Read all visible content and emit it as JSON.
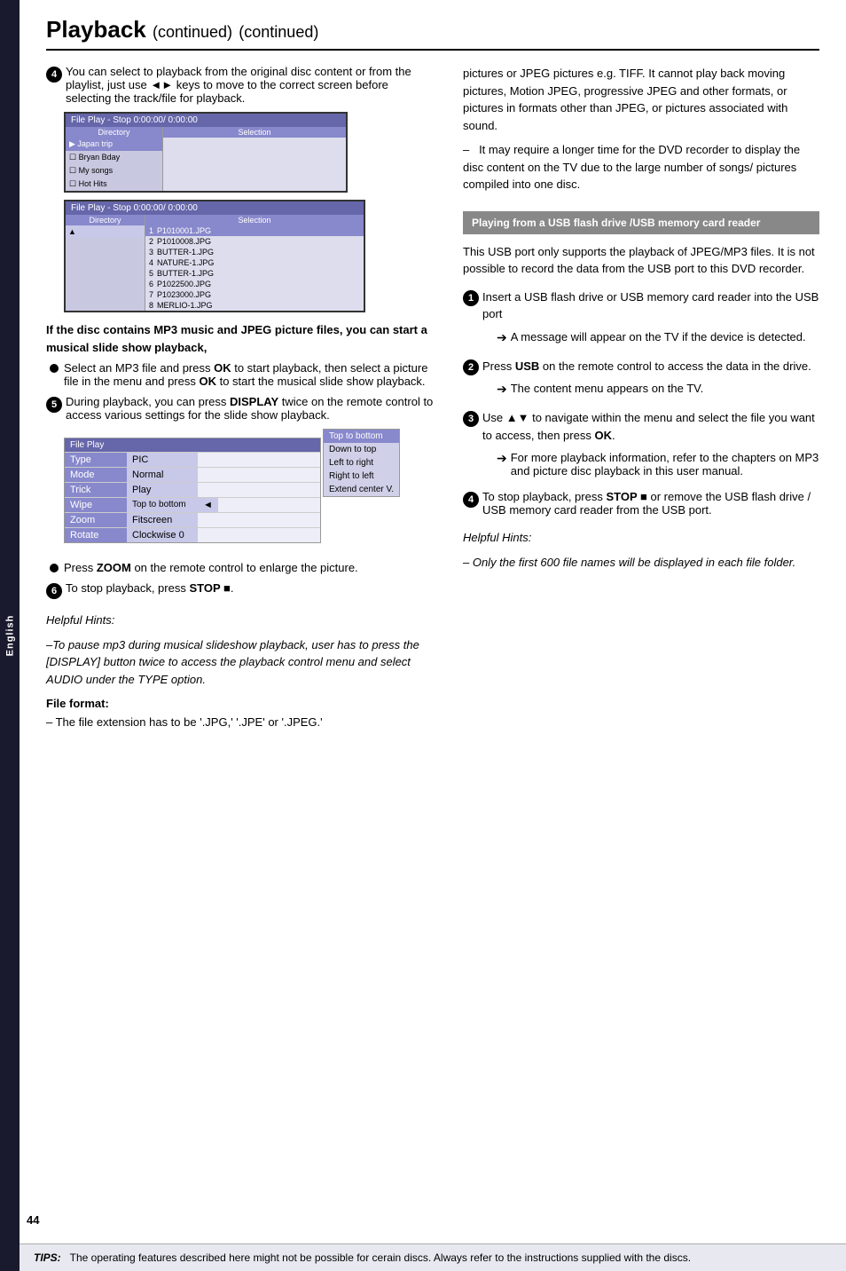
{
  "sidebar": {
    "label": "English"
  },
  "header": {
    "title": "Playback",
    "continued": "(continued)"
  },
  "left_col": {
    "step4": {
      "num": "4",
      "text": "You can select to playback from the original disc content or from the playlist, just use ",
      "keys": "◄►",
      "text2": " keys to move to the correct screen before selecting the track/file for playback."
    },
    "fileplay_screen1": {
      "title": "File Play - Stop 0:00:00/ 0:00:00",
      "dir_header": "Directory",
      "sel_header": "Selection",
      "dir_items": [
        "Japan trip",
        "Bryan Bday",
        "My songs",
        "Hot Hits"
      ],
      "dir_selected": 0
    },
    "fileplay_screen2": {
      "title": "File Play - Stop 0:00:00/ 0:00:00",
      "dir_header": "Directory",
      "sel_header": "Selection",
      "files": [
        {
          "num": "1",
          "name": "P1010001.JPG"
        },
        {
          "num": "2",
          "name": "P1010008.JPG"
        },
        {
          "num": "3",
          "name": "BUTTER-1.JPG"
        },
        {
          "num": "4",
          "name": "NATURE-1.JPG"
        },
        {
          "num": "5",
          "name": "BUTTER-1.JPG"
        },
        {
          "num": "6",
          "name": "P1022500.JPG"
        },
        {
          "num": "7",
          "name": "P1023000.JPG"
        },
        {
          "num": "8",
          "name": "MERLIO-1.JPG"
        }
      ]
    },
    "mp3_jpeg_header": "If the disc contains MP3 music and JPEG picture files, you can start a musical slide show playback,",
    "bullet1": {
      "text1": "Select an MP3 file and press ",
      "ok": "OK",
      "text2": " to start playback, then select a picture file in the menu and press ",
      "ok2": "OK",
      "text3": " to start the musical slide show playback."
    },
    "step5": {
      "num": "5",
      "text1": "During playback, you can press ",
      "display": "DISPLAY",
      "text2": " twice on the remote control to access various settings for the slide show playback."
    },
    "fileplay_settings": {
      "title": "File Play",
      "rows": [
        {
          "label": "Type",
          "value": "PIC"
        },
        {
          "label": "Mode",
          "value": "Normal"
        },
        {
          "label": "Trick",
          "value": "Play"
        },
        {
          "label": "Wipe",
          "value": "Top to bottom",
          "has_arrow": true,
          "has_dropdown": true
        },
        {
          "label": "Zoom",
          "value": "Fitscreen"
        },
        {
          "label": "Rotate",
          "value": "Clockwise 0"
        }
      ],
      "dropdown_items": [
        {
          "text": "Top to bottom",
          "selected": true
        },
        {
          "text": "Down to top",
          "selected": false
        },
        {
          "text": "Left to right",
          "selected": false
        },
        {
          "text": "Right to left",
          "selected": false
        },
        {
          "text": "Extend center V.",
          "selected": false
        }
      ]
    },
    "zoom_bullet": {
      "text1": "Press ",
      "zoom": "ZOOM",
      "text2": " on the remote control to enlarge the picture."
    },
    "step6": {
      "num": "6",
      "text1": "To stop playback, press ",
      "stop": "STOP",
      "stop_symbol": "■",
      "text2": "."
    },
    "helpful_hints": {
      "title": "Helpful Hints:",
      "lines": [
        "–To pause mp3 during musical slideshow playback, user has to press the [DISPLAY] button twice to access the playback control menu and select AUDIO under the TYPE option."
      ]
    },
    "file_format": {
      "title": "File format:",
      "lines": [
        "–  The file extension has to be '.JPG,' '.JPE' or '.JPEG.'"
      ]
    }
  },
  "right_col": {
    "intro_text": "pictures or JPEG pictures e.g. TIFF. It cannot play back moving pictures, Motion JPEG, progressive JPEG and other formats, or pictures in formats other than JPEG, or pictures associated with sound.",
    "dvd_note": "–   It may require a longer time for the DVD recorder to display the disc content on the TV due to the large number of songs/ pictures compiled into one disc.",
    "usb_header": "Playing from a USB flash drive /USB memory card reader",
    "usb_intro": "This USB port only supports the playback of JPEG/MP3 files. It is not possible to record the data from the USB port to this DVD recorder.",
    "usb_steps": [
      {
        "num": "1",
        "text": "Insert a USB flash drive or USB memory card reader into the USB port",
        "sub": "A message will appear on the TV if the device is detected."
      },
      {
        "num": "2",
        "text1": "Press ",
        "usb": "USB",
        "text2": " on the remote control to access the data in the drive.",
        "sub": "The content menu appears on the TV."
      },
      {
        "num": "3",
        "text1": "Use ",
        "nav": "▲▼",
        "text2": " to navigate within the menu and select the file you want to access, then press ",
        "ok": "OK",
        "text3": ".",
        "sub": "For more playback information, refer to the chapters on MP3 and picture disc playback in this user manual."
      },
      {
        "num": "4",
        "text1": "To stop playback, press ",
        "stop": "STOP",
        "stop_symbol": "■",
        "text2": " or remove the USB flash drive / USB memory card reader from the USB port."
      }
    ],
    "helpful_hints2": {
      "title": "Helpful Hints:",
      "lines": [
        "– Only the first 600 file names will be displayed in each file folder."
      ]
    }
  },
  "tips": {
    "label": "TIPS:",
    "text": "The operating features described here might not be possible for cerain discs. Always refer to the instructions supplied with the discs."
  },
  "page_num": "44"
}
